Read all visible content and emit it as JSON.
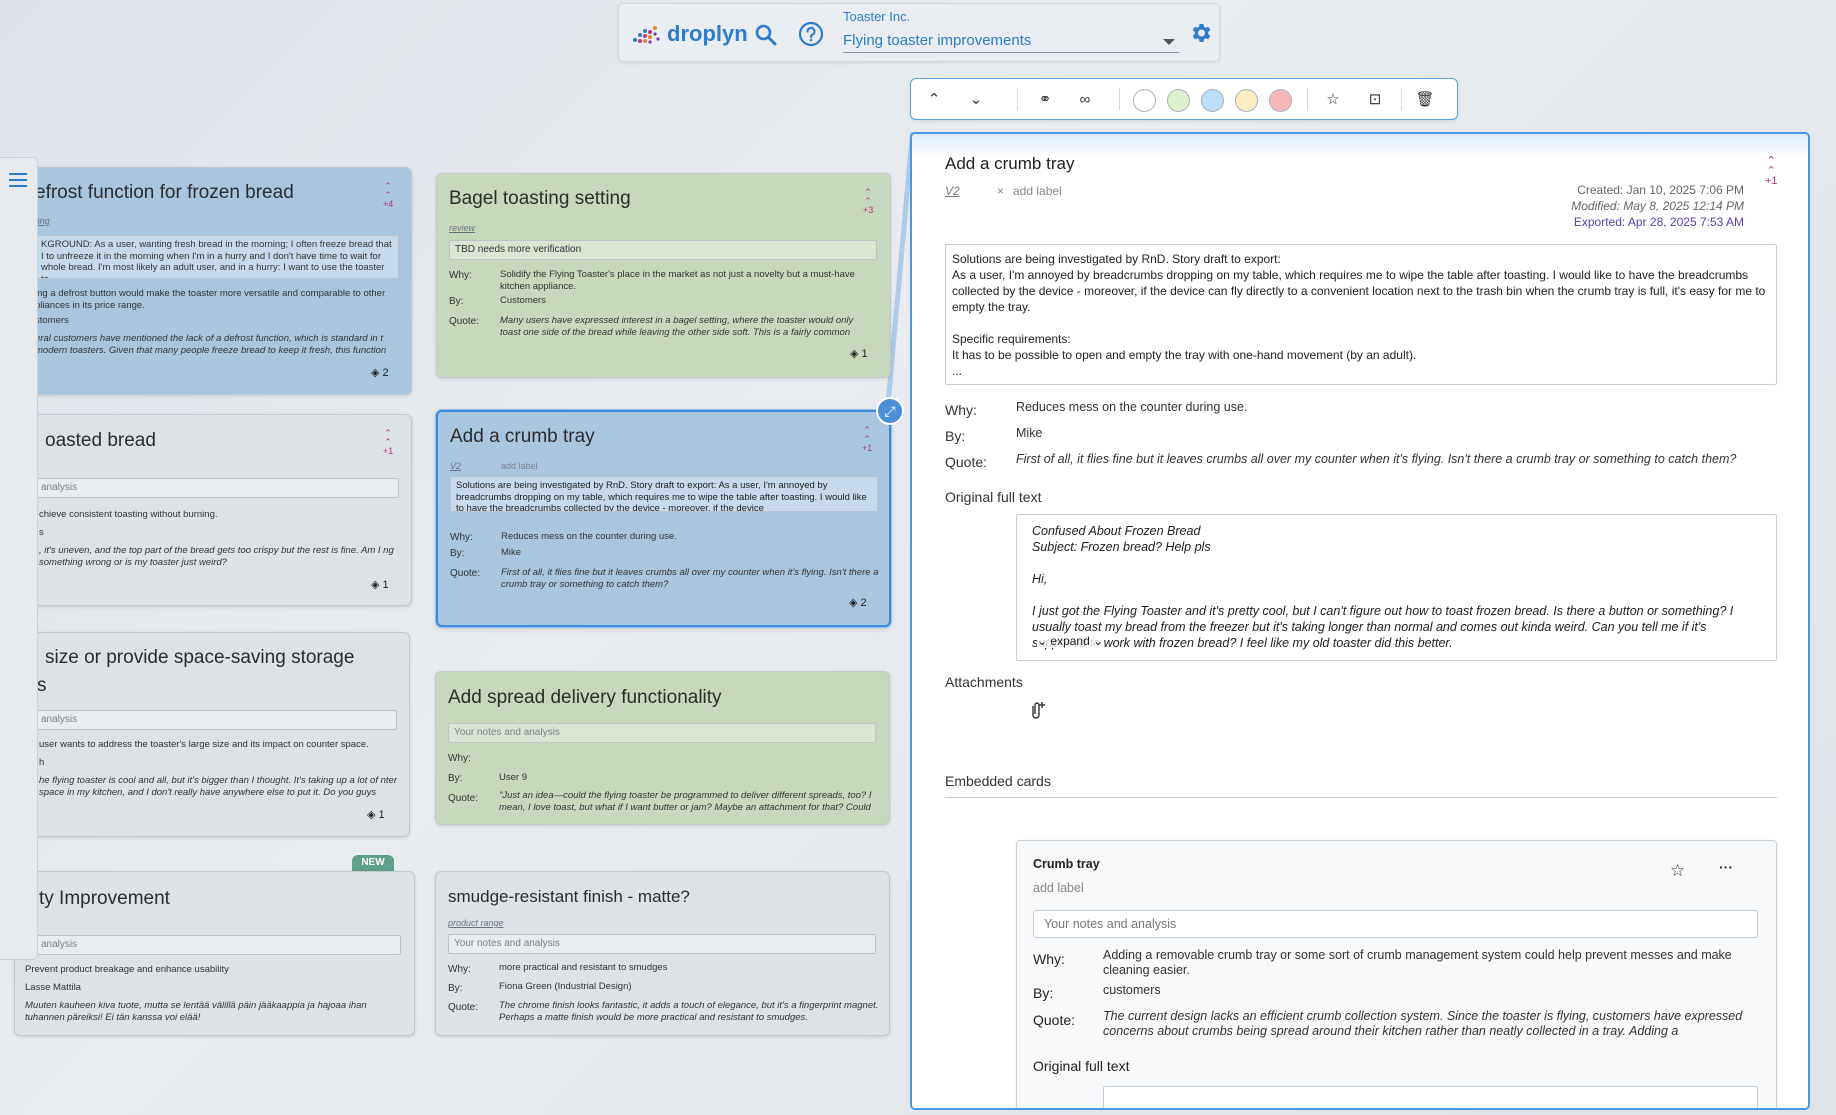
{
  "app": {
    "name": "droplyn"
  },
  "header": {
    "org": "Toaster Inc.",
    "project": "Flying toaster improvements"
  },
  "colors": {
    "accent": "#2f7cc8",
    "priority": "#b5347f",
    "card_blue": "#a8c6e0",
    "card_green": "#c8d8bd",
    "card_gray": "#dde2e7",
    "badge_new": "#5fa08a"
  },
  "toolbar": {
    "icons": [
      "move-top-icon",
      "move-bottom-icon",
      "connect-icon",
      "link-icon",
      "star-icon",
      "archive-icon",
      "delete-icon"
    ],
    "swatches": [
      "#ffffff",
      "#ddf0cc",
      "#bcdff9",
      "#faeec2",
      "#f7b6b6"
    ]
  },
  "cards": {
    "c1": {
      "title": "efrost function for frozen bread",
      "label": "ting",
      "prio": "+4",
      "stack": "2",
      "note": "KGROUND: As a user, wanting fresh bread in the morning; I often freeze bread that I to unfreeze it in the morning when I'm in a hurry and I don't have time to wait for whole bread. I'm most likely an adult user, and in a hurry: I want to use the toaster to",
      "why": "ing a defrost button would make the toaster more versatile and comparable to other pliances in its price range.",
      "by": "stomers",
      "quote": "eral customers have mentioned the lack of a defrost function, which is standard in t modern toasters. Given that many people freeze bread to keep it fresh, this function"
    },
    "c2": {
      "title": "Bagel toasting setting",
      "label": "review",
      "prio": "+3",
      "stack": "1",
      "note": "TBD needs more verification",
      "why": "Solidify the Flying Toaster's place in the market as not just a novelty but a must-have kitchen appliance.",
      "by": "Customers",
      "quote": "Many users have expressed interest in a bagel setting, where the toaster would only toast one side of the bread while leaving the other side soft. This is a fairly common feature in"
    },
    "c3": {
      "title": "oasted bread",
      "prio": "+1",
      "stack": "1",
      "note": "analysis",
      "why": "chieve consistent toasting without burning.",
      "by": "s",
      "quote": ", it's uneven, and the top part of the bread gets too crispy but the rest is fine. Am I ng something wrong or is my toaster just weird?"
    },
    "c4": {
      "title": "Add a crumb tray",
      "label": "V2",
      "add_label": "add label",
      "prio": "+1",
      "stack": "2",
      "note": "Solutions are being investigated by RnD. Story draft to export: As a user, I'm annoyed by breadcrumbs dropping on my table, which requires me to wipe the table after toasting. I would like to have the breadcrumbs collected by the device - moreover, if the device",
      "why": "Reduces mess on the counter during use.",
      "by": "Mike",
      "quote": "First of all, it flies fine but it leaves crumbs all over my counter when it's flying. Isn't there a crumb tray or something to catch them?"
    },
    "c5": {
      "title": "size or provide space-saving storage",
      "title2": "s",
      "stack": "1",
      "note": "analysis",
      "why": "user wants to address the toaster's large size and its impact on counter space.",
      "by": "h",
      "quote": "he flying toaster is cool and all, but it's bigger than I thought. It's taking up a lot of nter space in my kitchen, and I don't really have anywhere else to put it. Do you guys"
    },
    "c6": {
      "title": "Add spread delivery functionality",
      "note": "Your notes and analysis",
      "why": "",
      "by": "User 9",
      "quote": "\"Just an idea—could the flying toaster be programmed to deliver different spreads, too? I mean, I love toast, but what if I want butter or jam? Maybe an attachment for that? Could"
    },
    "c7": {
      "title": "ty Improvement",
      "badge": "NEW",
      "note": "analysis",
      "why": "Prevent product breakage and enhance usability",
      "by": "Lasse Mattila",
      "quote": "Muuten kauheen kiva tuote, mutta se lentää välillä päin jääkaappia ja hajoaa ihan tuhannen päreiksi! Ei tän kanssa voi elää!"
    },
    "c8": {
      "title": "smudge-resistant finish - matte?",
      "label": "product range",
      "note": "Your notes and analysis",
      "why": "more practical and resistant to smudges",
      "by": "Fiona Green (Industrial Design)",
      "quote": "The chrome finish looks fantastic, it adds a touch of elegance, but it's a fingerprint magnet. Perhaps a matte finish would be more practical and resistant to smudges."
    }
  },
  "labels": {
    "why": "Why:",
    "by": "By:",
    "quote": "Quote:"
  },
  "detail": {
    "title": "Add a crumb tray",
    "version": "V2",
    "remove": "×",
    "add_label": "add label",
    "prio": "+1",
    "created": "Created: Jan 10, 2025 7:06 PM",
    "modified": "Modified: May 8, 2025 12:14 PM",
    "exported": "Exported: Apr 28, 2025 7:53 AM",
    "desc1": "Solutions are being investigated by RnD. Story draft to export:",
    "desc2": "As a user, I'm annoyed by breadcrumbs dropping on my table, which requires me to wipe the table after toasting. I would like to have the breadcrumbs collected by the device - moreover, if the device can fly directly to a convenient location next to the trash bin when the crumb tray is full, it's easy for me to empty the tray.",
    "desc3": "Specific requirements:",
    "desc4": "It has to be possible to open and empty the tray with one-hand movement (by an adult).",
    "desc5": "...",
    "why_label": "Why:",
    "why": "Reduces mess on the counter during use.",
    "by_label": "By:",
    "by": "Mike",
    "quote_label": "Quote:",
    "quote": "First of all, it flies fine but it leaves crumbs all over my counter when it's flying. Isn't there a crumb tray or something to catch them?",
    "orig_title": "Original full text",
    "orig1": "Confused About Frozen Bread",
    "orig2": "Subject: Frozen bread? Help pls",
    "orig3": "Hi,",
    "orig4": "I just got the Flying Toaster and it's pretty cool, but I can't figure out how to toast frozen bread. Is there a button or something? I usually toast my bread from the freezer but it's taking longer than normal and comes out kinda weird. Can you tell me if it's supposed to work with frozen bread? I feel like my old toaster did this better.",
    "expand": "expand",
    "attachments_title": "Attachments",
    "embedded_title": "Embedded cards",
    "embedded": {
      "title": "Crumb tray",
      "add_label": "add label",
      "note_placeholder": "Your notes and analysis",
      "why_label": "Why:",
      "why": "Adding a removable crumb tray or some sort of crumb management system could help prevent messes and make cleaning easier.",
      "by_label": "By:",
      "by": "customers",
      "quote_label": "Quote:",
      "quote": "The current design lacks an efficient crumb collection system. Since the toaster is flying, customers have expressed concerns about crumbs being spread around their kitchen rather than neatly collected in a tray. Adding a",
      "orig_title": "Original full text",
      "menu": "···"
    }
  }
}
